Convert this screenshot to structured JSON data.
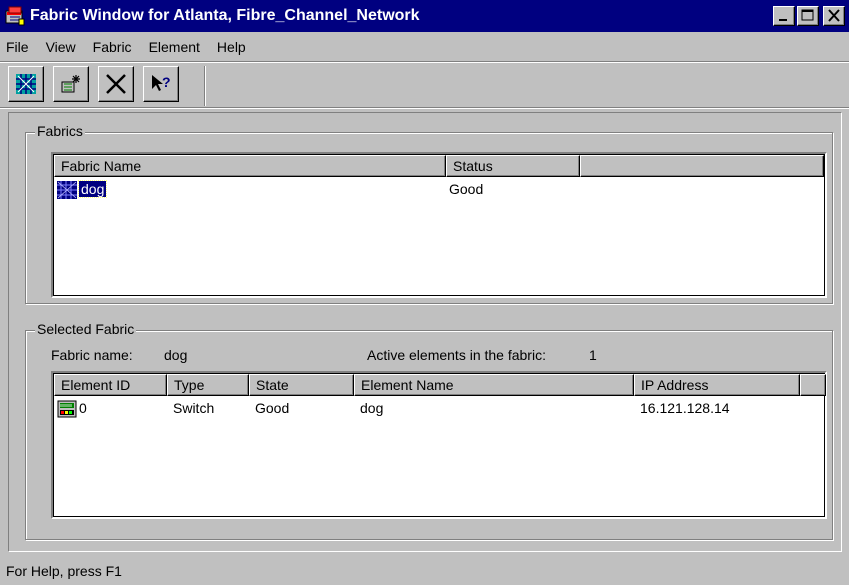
{
  "window": {
    "title": "Fabric Window for Atlanta, Fibre_Channel_Network",
    "controls": {
      "minimize": "minimize",
      "maximize": "maximize",
      "close": "close"
    }
  },
  "menu": [
    {
      "label": "File"
    },
    {
      "label": "View"
    },
    {
      "label": "Fabric"
    },
    {
      "label": "Element"
    },
    {
      "label": "Help"
    }
  ],
  "toolbar": {
    "buttons": [
      {
        "icon": "fabric-icon"
      },
      {
        "icon": "discover-icon"
      },
      {
        "icon": "delete-x-icon"
      },
      {
        "icon": "context-help-icon"
      }
    ]
  },
  "fabrics": {
    "group_label": "Fabrics",
    "columns": [
      "Fabric Name",
      "Status",
      ""
    ],
    "rows": [
      {
        "name": "dog",
        "status": "Good",
        "selected": true
      }
    ]
  },
  "selected_fabric": {
    "group_label": "Selected Fabric",
    "fabric_name_label": "Fabric name:",
    "fabric_name_value": "dog",
    "active_label": "Active elements in the fabric:",
    "active_value": "1",
    "columns": [
      "Element ID",
      "Type",
      "State",
      "Element Name",
      "IP Address",
      ""
    ],
    "rows": [
      {
        "id": "0",
        "type": "Switch",
        "state": "Good",
        "name": "dog",
        "ip": "16.121.128.14"
      }
    ]
  },
  "status_bar": {
    "text": "For Help, press F1"
  },
  "colors": {
    "titlebar": "#000080",
    "face": "#c0c0c0",
    "selection": "#000080"
  }
}
